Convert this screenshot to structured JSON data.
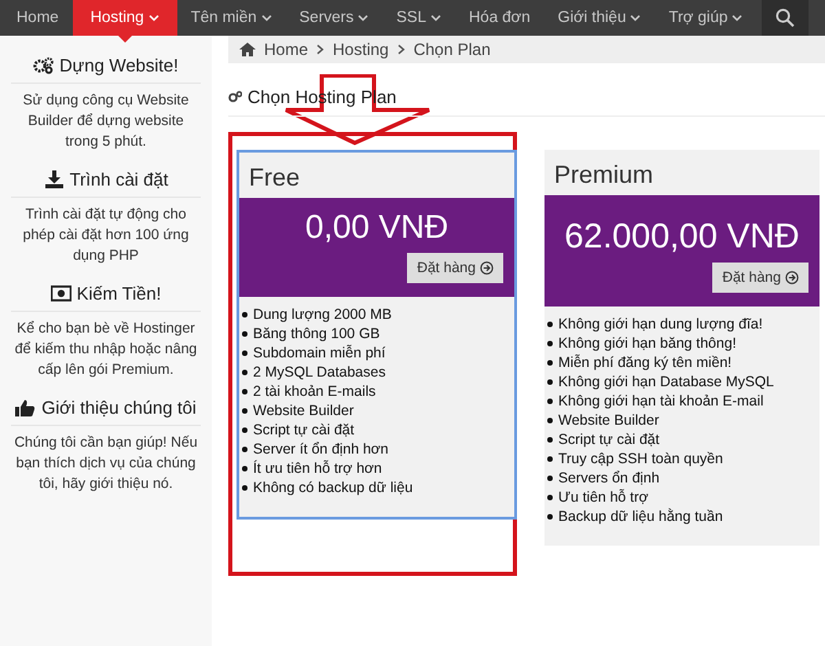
{
  "nav": {
    "items": [
      {
        "label": "Home",
        "selected": false,
        "dropdown": false
      },
      {
        "label": "Hosting",
        "selected": true,
        "dropdown": true
      },
      {
        "label": "Tên miền",
        "selected": false,
        "dropdown": true
      },
      {
        "label": "Servers",
        "selected": false,
        "dropdown": true
      },
      {
        "label": "SSL",
        "selected": false,
        "dropdown": true
      },
      {
        "label": "Hóa đơn",
        "selected": false,
        "dropdown": false
      },
      {
        "label": "Giới thiệu",
        "selected": false,
        "dropdown": true
      },
      {
        "label": "Trợ giúp",
        "selected": false,
        "dropdown": true
      }
    ]
  },
  "sidebar": {
    "sections": [
      {
        "title": "Dựng Website!",
        "text": "Sử dụng công cụ Website Builder để dựng website trong 5 phút."
      },
      {
        "title": "Trình cài đặt",
        "text": "Trình cài đặt tự động cho phép cài đặt hơn 100 ứng dụng PHP"
      },
      {
        "title": "Kiếm Tiền!",
        "text": "Kể cho bạn bè về Hostinger để kiếm thu nhập hoặc nâng cấp lên gói Premium."
      },
      {
        "title": "Giới thiệu chúng tôi",
        "text": "Chúng tôi cần bạn giúp! Nếu bạn thích dịch vụ của chúng tôi, hãy giới thiệu nó."
      }
    ]
  },
  "breadcrumb": [
    {
      "label": "Home"
    },
    {
      "label": "Hosting"
    },
    {
      "label": "Chọn Plan"
    }
  ],
  "page_title": "Chọn Hosting Plan",
  "plans": [
    {
      "name": "Free",
      "price": "0,00 VNĐ",
      "button": "Đặt hàng",
      "highlighted": true,
      "features": [
        "Dung lượng 2000 MB",
        "Băng thông 100 GB",
        "Subdomain miễn phí",
        "2 MySQL Databases",
        "2 tài khoản E-mails",
        "Website Builder",
        "Script tự cài đặt",
        "Server ít ổn định hơn",
        "Ít ưu tiên hỗ trợ hơn",
        "Không có backup dữ liệu"
      ]
    },
    {
      "name": "Premium",
      "price": "62.000,00 VNĐ",
      "button": "Đặt hàng",
      "highlighted": false,
      "features": [
        "Không giới hạn dung lượng đĩa!",
        "Không giới hạn băng thông!",
        "Miễn phí đăng ký tên miền!",
        "Không giới hạn Database MySQL",
        "Không giới hạn tài khoản E-mail",
        "Website Builder",
        "Script tự cài đặt",
        "Truy cập SSH toàn quyền",
        "Servers ổn định",
        "Ưu tiên hỗ trợ",
        "Backup dữ liệu hằng tuần"
      ]
    }
  ]
}
